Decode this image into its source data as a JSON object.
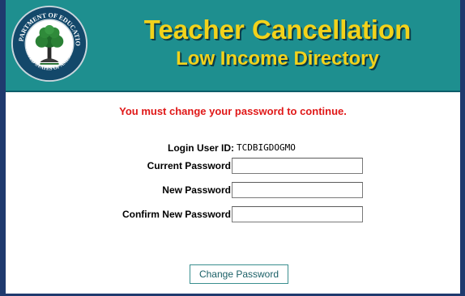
{
  "header": {
    "title": "Teacher Cancellation",
    "subtitle": "Low Income Directory",
    "seal_top_text": "DEPARTMENT OF EDUCATION",
    "seal_bottom_text": "UNITED STATES OF AMERICA"
  },
  "message": "You must change your password to continue.",
  "form": {
    "login_label": "Login User ID:",
    "login_value": "TCDBIGDOGMO",
    "current_label": "Current Password:",
    "current_value": "",
    "new_label": "New Password:",
    "new_value": "",
    "confirm_label": "Confirm New Password:",
    "confirm_value": ""
  },
  "actions": {
    "change_password_label": "Change Password"
  },
  "colors": {
    "header_bg": "#1e8f8f",
    "title_text": "#f2d21b",
    "warning_text": "#e01818",
    "frame_border": "#1f3a6e"
  }
}
